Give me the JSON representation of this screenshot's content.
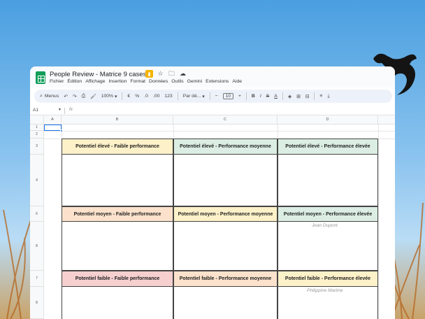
{
  "window": {
    "title": "People Review - Matrice 9 cases",
    "menu": [
      "Fichier",
      "Édition",
      "Affichage",
      "Insertion",
      "Format",
      "Données",
      "Outils",
      "Gemini",
      "Extensions",
      "Aide"
    ]
  },
  "toolbar": {
    "search_label": "Menus",
    "zoom": "100%",
    "currency": "€",
    "percent": "%",
    "dec_decrease": ".0",
    "dec_increase": ".00",
    "number_format": "123",
    "font": "Par dé...",
    "font_size": "10",
    "bold": "B",
    "italic": "I",
    "strike": "S",
    "text_color": "A"
  },
  "formula_bar": {
    "cell_ref": "A1",
    "fx": "fx",
    "value": ""
  },
  "columns": [
    "A",
    "B",
    "C",
    "D"
  ],
  "rows": [
    "1",
    "2",
    "3",
    "4",
    "6",
    "8",
    "7",
    "8"
  ],
  "matrix": {
    "row1": [
      {
        "label": "Potentiel élevé - Faible performance",
        "color": "#fdf1c9"
      },
      {
        "label": "Potentiel élevé - Performance moyenne",
        "color": "#dceee3"
      },
      {
        "label": "Potentiel élevé - Performance élevée",
        "color": "#dceee3"
      }
    ],
    "row2": [
      {
        "label": "Potentiel moyen - Faible performance",
        "color": "#fce2cc"
      },
      {
        "label": "Potentiel moyen - Performance moyenne",
        "color": "#fdf1c9"
      },
      {
        "label": "Potentiel moyen - Performance élevée",
        "color": "#dceee3"
      }
    ],
    "row3": [
      {
        "label": "Potentiel faible - Faible performance",
        "color": "#f6cfcf"
      },
      {
        "label": "Potentiel faible - Performance moyenne",
        "color": "#fce2cc"
      },
      {
        "label": "Potentiel faible - Performance élevée",
        "color": "#fdf1c9"
      }
    ]
  },
  "people": {
    "p1": "Jean Dupont",
    "p2": "Philippine Martine"
  },
  "colors": {
    "accent": "#1a73e8",
    "sheets_green": "#0f9d58"
  }
}
